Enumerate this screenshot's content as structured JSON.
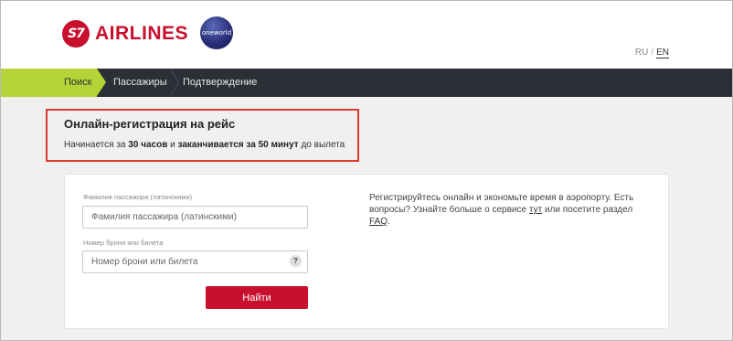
{
  "header": {
    "brand_mark": "S7",
    "brand_name": "AIRLINES",
    "alliance": "oneworld",
    "lang": {
      "ru": "RU",
      "sep": "/",
      "en": "EN"
    }
  },
  "nav": {
    "items": [
      {
        "label": "Поиск",
        "active": true
      },
      {
        "label": "Пассажиры",
        "active": false
      },
      {
        "label": "Подтверждение",
        "active": false
      }
    ]
  },
  "checkin": {
    "title": "Онлайн-регистрация на рейс",
    "sub_prefix": "Начинается за",
    "sub_start": "30 часов",
    "sub_and": "и",
    "sub_end": "заканчивается за 50 минут",
    "sub_suffix": "до вылета"
  },
  "form": {
    "surname_label": "Фамилия пассажира (латинскими)",
    "surname_placeholder": "Фамилия пассажира (латинскими)",
    "booking_label": "Номер брони или билета",
    "booking_placeholder": "Номер брони или билета",
    "help_icon": "?",
    "submit_label": "Найти"
  },
  "info": {
    "text_1": "Регистрируйтесь онлайн и экономьте время в аэропорту. Есть вопросы? Узнайте больше о сервисе",
    "link_here": "тут",
    "text_2": "или посетите раздел",
    "link_faq": "FAQ",
    "text_3": "."
  },
  "colors": {
    "brand_red": "#c8102e",
    "nav_bg": "#2b3036",
    "nav_active": "#b4d336",
    "highlight_border": "#e03a2f"
  }
}
